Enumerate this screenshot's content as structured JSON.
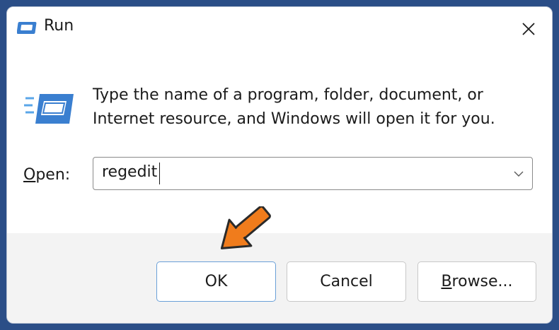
{
  "window": {
    "title": "Run",
    "close_icon": "close-icon"
  },
  "content": {
    "description_line1": "Type the name of a program, folder, document, or",
    "description_line2": "Internet resource, and Windows will open it for you.",
    "open_label_underlined": "O",
    "open_label_rest": "pen:",
    "open_value": "regedit"
  },
  "buttons": {
    "ok_label": "OK",
    "cancel_label": "Cancel",
    "browse_label_underlined": "B",
    "browse_label_rest": "rowse..."
  },
  "colors": {
    "desktop_bg": "#2b4e87",
    "window_bg": "#ffffff",
    "footer_bg": "#f3f3f3",
    "accent_blue": "#3a7fd0",
    "arrow_orange": "#f07c1c"
  }
}
